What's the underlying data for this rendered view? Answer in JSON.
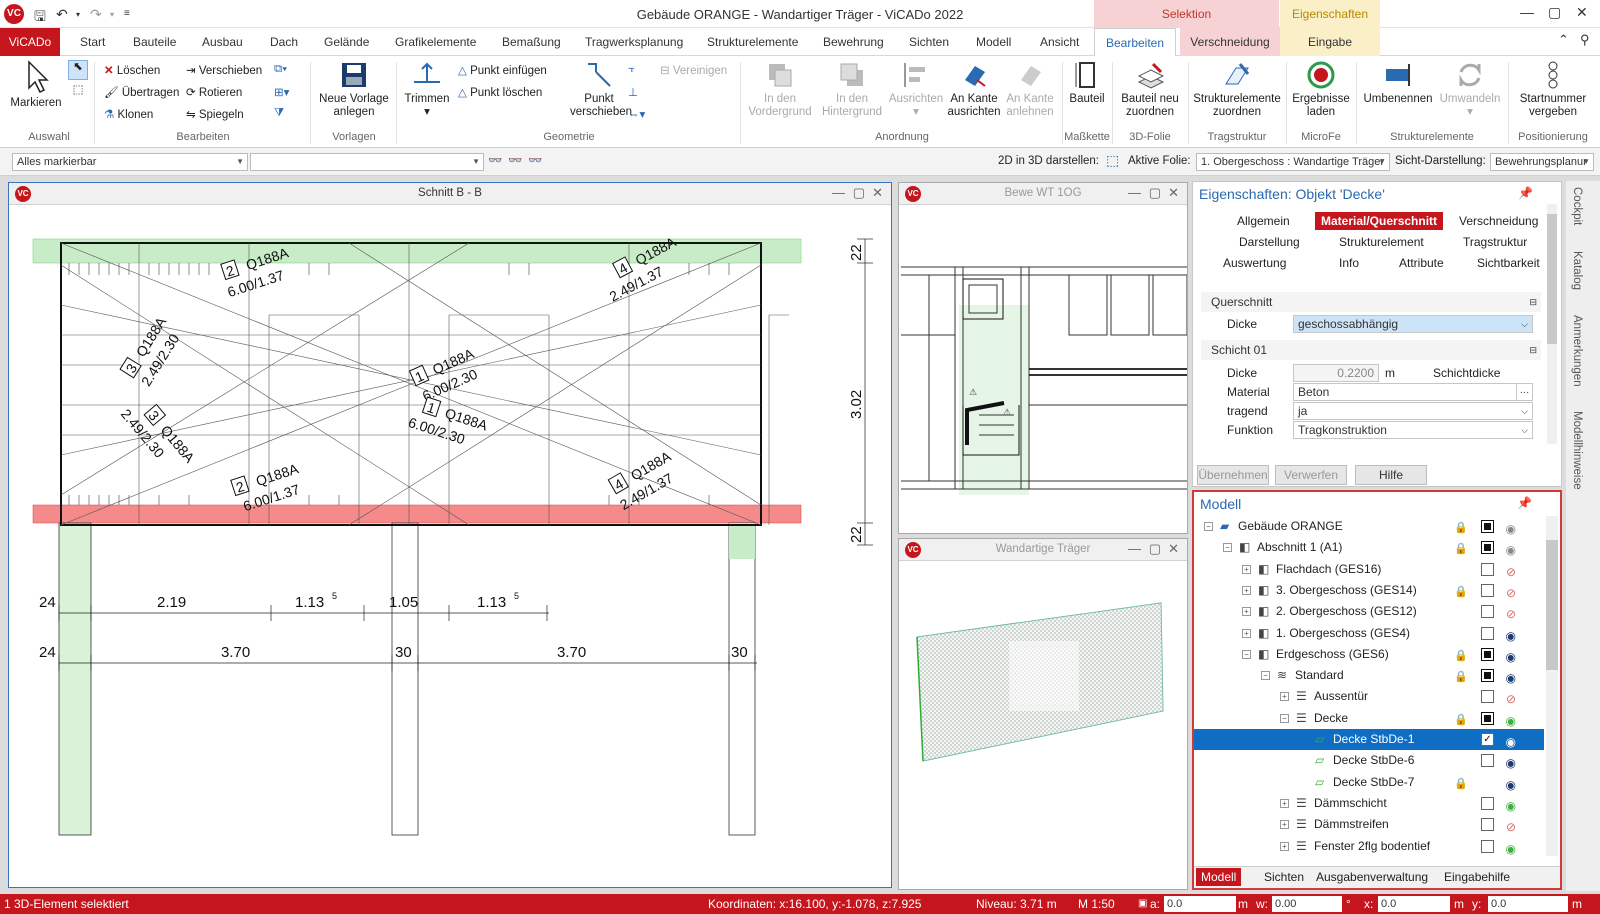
{
  "window": {
    "title": "Gebäude ORANGE - Wandartiger Träger - ViCADo 2022",
    "logo": "VC",
    "context_selection": "Selektion",
    "context_properties": "Eigenschaften"
  },
  "menu": {
    "app": "ViCADo",
    "items": [
      "Start",
      "Bauteile",
      "Ausbau",
      "Dach",
      "Gelände",
      "Grafikelemente",
      "Bemaßung",
      "Tragwerksplanung",
      "Strukturelemente",
      "Bewehrung",
      "Sichten",
      "Modell",
      "Ansicht"
    ],
    "active_tab": "Bearbeiten",
    "tab_verschneidung": "Verschneidung",
    "tab_eingabe": "Eingabe"
  },
  "ribbon": {
    "markieren": "Markieren",
    "loeschen": "Löschen",
    "uebertragen": "Übertragen",
    "klonen": "Klonen",
    "verschieben": "Verschieben",
    "rotieren": "Rotieren",
    "spiegeln": "Spiegeln",
    "neue_vorlage": [
      "Neue Vorlage",
      "anlegen"
    ],
    "trimmen": "Trimmen",
    "punkt_einfuegen": "Punkt einfügen",
    "punkt_loeschen": "Punkt löschen",
    "punkt_verschieben": [
      "Punkt",
      "verschieben"
    ],
    "vereinigen": "Vereinigen",
    "in_den_vordergrund": [
      "In den",
      "Vordergrund"
    ],
    "in_den_hintergrund": [
      "In den",
      "Hintergrund"
    ],
    "ausrichten": "Ausrichten",
    "an_kante_ausrichten": [
      "An Kante",
      "ausrichten"
    ],
    "an_kante_anlehnen": [
      "An Kante",
      "anlehnen"
    ],
    "bauteil": "Bauteil",
    "bauteil_neu_zuordnen": [
      "Bauteil neu",
      "zuordnen"
    ],
    "strukturelemente_zuordnen": [
      "Strukturelemente",
      "zuordnen"
    ],
    "ergebnisse_laden": [
      "Ergebnisse",
      "laden"
    ],
    "umbenennen": "Umbenennen",
    "umwandeln": "Umwandeln",
    "startnummer_vergeben": [
      "Startnummer",
      "vergeben"
    ],
    "groups": [
      "Auswahl",
      "Bearbeiten",
      "Vorlagen",
      "Geometrie",
      "Anordnung",
      "Maßkette",
      "3D-Folie",
      "Tragstruktur",
      "MicroFe",
      "Strukturelemente",
      "Positionierung"
    ]
  },
  "toolbar": {
    "filter": "Alles markierbar",
    "filter2": "",
    "label_2d3d": "2D in 3D darstellen:",
    "label_folie": "Aktive Folie:",
    "folie_value": "1. Obergeschoss : Wandartige Träger",
    "label_sicht": "Sicht-Darstellung:",
    "sicht_value": "Bewehrungsplanur"
  },
  "panes": {
    "schnitt": "Schnitt B - B",
    "bewe": "Bewe WT 1OG",
    "wandartige": "Wandartige Träger"
  },
  "drawing": {
    "labels": [
      {
        "n": "2",
        "t": "Q188A",
        "d": "6.00/1.37"
      },
      {
        "n": "4",
        "t": "Q188A",
        "d": "2.49/1.37"
      },
      {
        "n": "3",
        "t": "Q188A",
        "d": "2.49/2.30"
      },
      {
        "n": "1",
        "t": "Q188A",
        "d": "6.00/2.30"
      },
      {
        "n": "3",
        "t": "Q188A",
        "d": "2.49/2.30"
      },
      {
        "n": "1",
        "t": "Q188A",
        "d": "6.00/2.30"
      },
      {
        "n": "2",
        "t": "Q188A",
        "d": "6.00/1.37"
      },
      {
        "n": "4",
        "t": "Q188A",
        "d": "2.49/1.37"
      }
    ],
    "dim_row1": [
      "24",
      "2.19",
      "1.13",
      "1.05",
      "1.13"
    ],
    "dim_row1_sup": "5",
    "dim_row2": [
      "24",
      "3.70",
      "30",
      "3.70",
      "30"
    ],
    "dim_vert": [
      "22",
      "3.02",
      "22"
    ]
  },
  "properties": {
    "title": "Eigenschaften: Objekt 'Decke'",
    "tabs": [
      "Allgemein",
      "Material/Querschnitt",
      "Verschneidung",
      "Darstellung",
      "Strukturelement",
      "Tragstruktur",
      "Auswertung",
      "Info",
      "Attribute",
      "Sichtbarkeit"
    ],
    "section_querschnitt": "Querschnitt",
    "dicke_label": "Dicke",
    "dicke_value": "geschossabhängig",
    "section_schicht": "Schicht 01",
    "schicht_dicke_label": "Dicke",
    "schicht_dicke_value": "0.2200",
    "schicht_dicke_unit": "m",
    "schichtdicke": "Schichtdicke",
    "material_label": "Material",
    "material_value": "Beton",
    "tragend_label": "tragend",
    "tragend_value": "ja",
    "funktion_label": "Funktion",
    "funktion_value": "Tragkonstruktion",
    "btn_uebernehmen": "Übernehmen",
    "btn_verwerfen": "Verwerfen",
    "btn_hilfe": "Hilfe"
  },
  "model": {
    "title": "Modell",
    "tree": [
      {
        "label": "Gebäude ORANGE",
        "level": 0,
        "lock": true,
        "cb": "f",
        "eye": "grey"
      },
      {
        "label": "Abschnitt 1 (A1)",
        "level": 1,
        "lock": true,
        "cb": "f",
        "eye": "grey"
      },
      {
        "label": "Flachdach (GES16)",
        "level": 2,
        "cb": "",
        "eye": "off"
      },
      {
        "label": "3. Obergeschoss (GES14)",
        "level": 2,
        "lock": true,
        "cb": "",
        "eye": "off"
      },
      {
        "label": "2. Obergeschoss (GES12)",
        "level": 2,
        "cb": "",
        "eye": "off"
      },
      {
        "label": "1. Obergeschoss (GES4)",
        "level": 2,
        "cb": "",
        "eye": "on"
      },
      {
        "label": "Erdgeschoss (GES6)",
        "level": 2,
        "lock": true,
        "cb": "f",
        "eye": "on"
      },
      {
        "label": "Standard",
        "level": 3,
        "lock": true,
        "cb": "f",
        "eye": "on"
      },
      {
        "label": "Aussentür",
        "level": 4,
        "cb": "",
        "eye": "off"
      },
      {
        "label": "Decke",
        "level": 4,
        "lock": true,
        "cb": "f",
        "eye": "green"
      },
      {
        "label": "Decke StbDe-1",
        "level": 5,
        "cb": "check",
        "eye": "on",
        "sel": true
      },
      {
        "label": "Decke StbDe-6",
        "level": 5,
        "cb": "",
        "eye": "on"
      },
      {
        "label": "Decke StbDe-7",
        "level": 5,
        "lock": true,
        "cb": "none",
        "eye": "on"
      },
      {
        "label": "Dämmschicht",
        "level": 4,
        "cb": "",
        "eye": "green"
      },
      {
        "label": "Dämmstreifen",
        "level": 4,
        "cb": "",
        "eye": "off"
      },
      {
        "label": "Fenster 2flg bodentief",
        "level": 4,
        "cb": "",
        "eye": "green"
      }
    ],
    "tabs": [
      "Modell",
      "Sichten",
      "Ausgabenverwaltung",
      "Eingabehilfe"
    ]
  },
  "sidebar": [
    "Cockpit",
    "Katalog",
    "Anmerkungen",
    "Modellhinweise"
  ],
  "status": {
    "selected": "1 3D-Element selektiert",
    "koordinaten": "Koordinaten: x:16.100, y:-1.078, z:7.925",
    "niveau": "Niveau: 3.71 m",
    "massstab": "M 1:50",
    "a_label": "a:",
    "a_value": "0.0",
    "a_unit": "m",
    "w_label": "w:",
    "w_value": "0.00",
    "w_unit": "°",
    "x_label": "x:",
    "x_value": "0.0",
    "x_unit": "m",
    "y_label": "y:",
    "y_value": "0.0",
    "y_unit": "m"
  },
  "colors": {
    "accent": "#c4161c",
    "blue": "#2a6ab0",
    "selection": "#0f6dc4",
    "slab_green": "#c8ecc8",
    "slab_red": "#f48a8a"
  }
}
